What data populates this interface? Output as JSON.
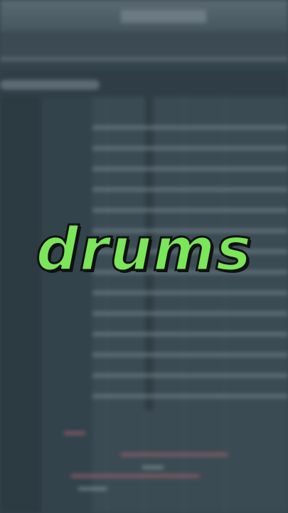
{
  "overlay": {
    "title": "drums"
  },
  "colors": {
    "title": "#7be65a",
    "outline": "#111111",
    "background": "#34444d",
    "accent_clip": "#a8606c"
  },
  "app": {
    "type": "daw-playlist",
    "track_rows": 14
  }
}
